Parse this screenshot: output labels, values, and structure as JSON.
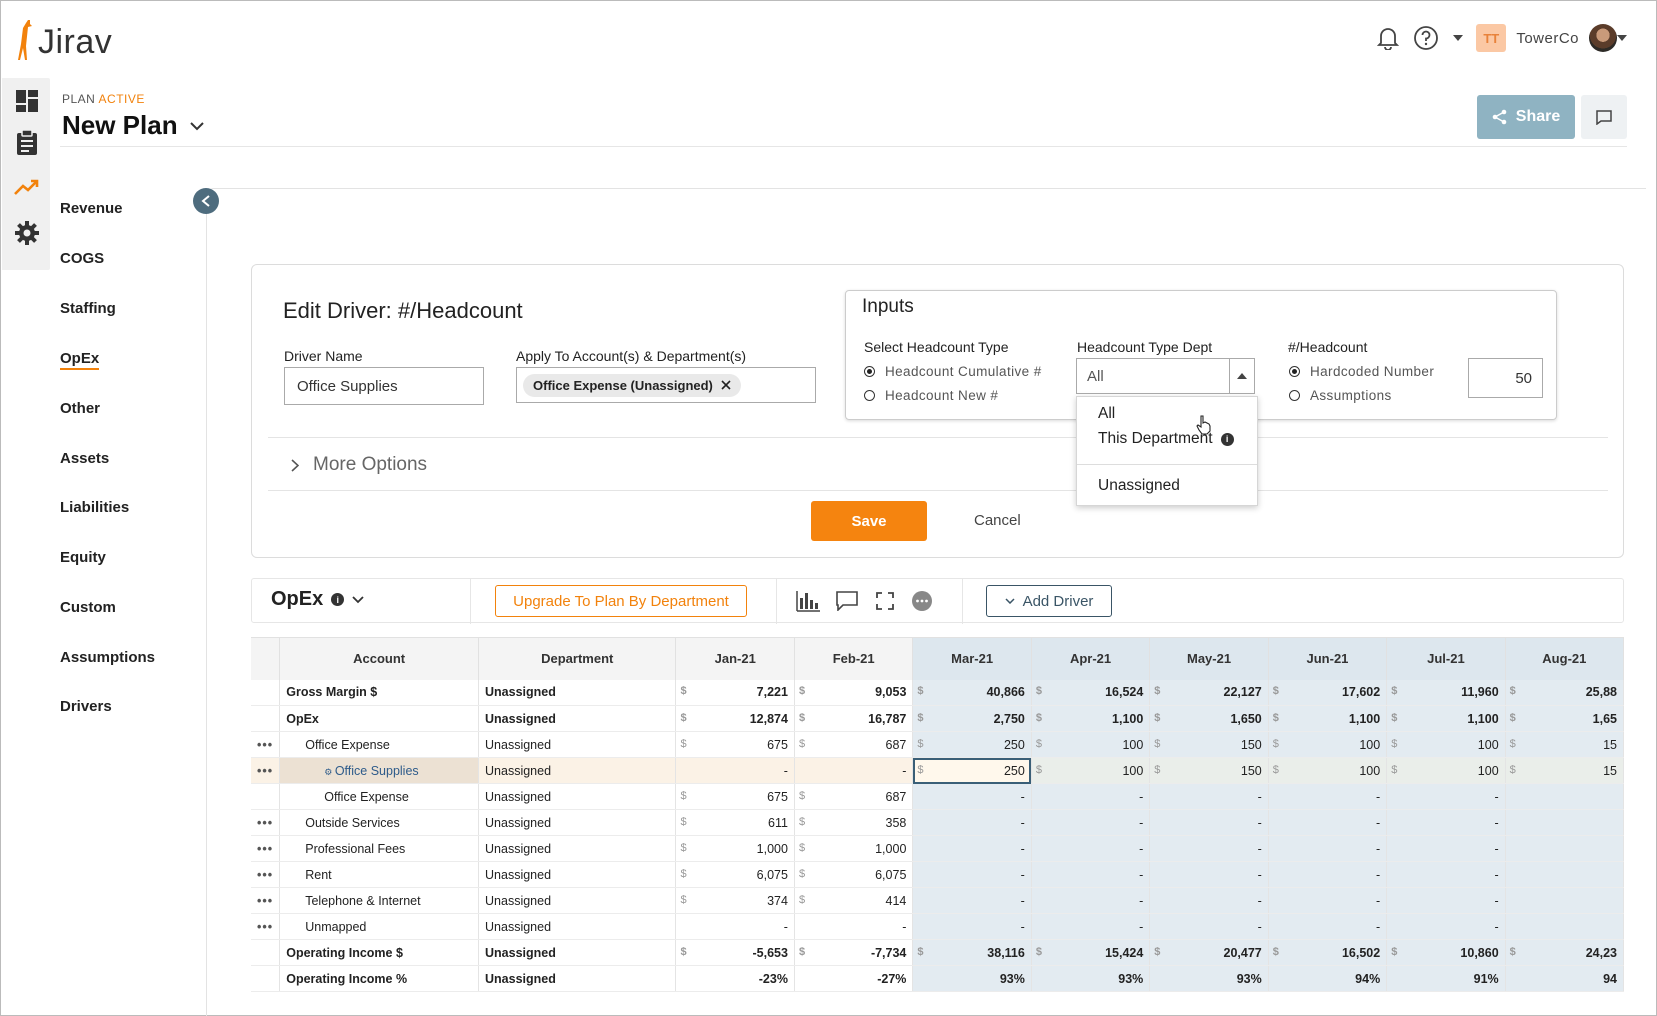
{
  "app": {
    "name": "Jirav"
  },
  "header": {
    "org_initials": "TT",
    "org_name": "TowerCo",
    "plan_label": "PLAN",
    "plan_status": "ACTIVE",
    "plan_name": "New Plan",
    "share_label": "Share"
  },
  "sidebar": {
    "items": [
      {
        "label": "Revenue"
      },
      {
        "label": "COGS"
      },
      {
        "label": "Staffing"
      },
      {
        "label": "OpEx",
        "active": true
      },
      {
        "label": "Other"
      },
      {
        "label": "Assets"
      },
      {
        "label": "Liabilities"
      },
      {
        "label": "Equity"
      },
      {
        "label": "Custom"
      },
      {
        "label": "Assumptions"
      },
      {
        "label": "Drivers"
      }
    ]
  },
  "edit_driver": {
    "title": "Edit Driver: #/Headcount",
    "driver_name_label": "Driver Name",
    "driver_name_value": "Office Supplies",
    "apply_label": "Apply To Account(s) & Department(s)",
    "apply_chip": "Office Expense (Unassigned)",
    "inputs_title": "Inputs",
    "headcount_type_label": "Select Headcount Type",
    "headcount_type_options": [
      {
        "label": "Headcount Cumulative #",
        "selected": true
      },
      {
        "label": "Headcount New #",
        "selected": false
      }
    ],
    "type_dept_label": "Headcount Type Dept",
    "type_dept_value": "All",
    "type_dept_options": [
      "All",
      "This Department",
      "Unassigned"
    ],
    "per_headcount_label": "#/Headcount",
    "per_headcount_options": [
      {
        "label": "Hardcoded Number",
        "selected": true
      },
      {
        "label": "Assumptions",
        "selected": false
      }
    ],
    "per_headcount_value": "50",
    "more_options_label": "More Options",
    "save_label": "Save",
    "cancel_label": "Cancel"
  },
  "toolbar": {
    "title": "OpEx",
    "upgrade_label": "Upgrade To Plan By Department",
    "add_driver_label": "Add Driver"
  },
  "table": {
    "columns": [
      "Account",
      "Department",
      "Jan-21",
      "Feb-21",
      "Mar-21",
      "Apr-21",
      "May-21",
      "Jun-21",
      "Jul-21",
      "Aug-21"
    ],
    "highlight_from_col": 4,
    "rows": [
      {
        "account": "Gross Margin $",
        "dept": "Unassigned",
        "bold": true,
        "dots": false,
        "indent": 0,
        "cells": [
          [
            "$",
            "7,221"
          ],
          [
            "$",
            "9,053"
          ],
          [
            "$",
            "40,866"
          ],
          [
            "$",
            "16,524"
          ],
          [
            "$",
            "22,127"
          ],
          [
            "$",
            "17,602"
          ],
          [
            "$",
            "11,960"
          ],
          [
            "$",
            "25,88"
          ]
        ]
      },
      {
        "account": "OpEx",
        "dept": "Unassigned",
        "bold": true,
        "dots": false,
        "indent": 0,
        "cells": [
          [
            "$",
            "12,874"
          ],
          [
            "$",
            "16,787"
          ],
          [
            "$",
            "2,750"
          ],
          [
            "$",
            "1,100"
          ],
          [
            "$",
            "1,650"
          ],
          [
            "$",
            "1,100"
          ],
          [
            "$",
            "1,100"
          ],
          [
            "$",
            "1,65"
          ]
        ]
      },
      {
        "account": "Office Expense",
        "dept": "Unassigned",
        "bold": false,
        "dots": true,
        "indent": 1,
        "cells": [
          [
            "$",
            "675"
          ],
          [
            "$",
            "687"
          ],
          [
            "$",
            "250"
          ],
          [
            "$",
            "100"
          ],
          [
            "$",
            "150"
          ],
          [
            "$",
            "100"
          ],
          [
            "$",
            "100"
          ],
          [
            "$",
            "15"
          ]
        ]
      },
      {
        "account": "Office Supplies",
        "dept": "Unassigned",
        "bold": false,
        "dots": true,
        "indent": 2,
        "selected": true,
        "sub": true,
        "cells": [
          [
            "",
            "-"
          ],
          [
            "",
            "-"
          ],
          [
            "$",
            "250"
          ],
          [
            "$",
            "100"
          ],
          [
            "$",
            "150"
          ],
          [
            "$",
            "100"
          ],
          [
            "$",
            "100"
          ],
          [
            "$",
            "15"
          ]
        ]
      },
      {
        "account": "Office Expense",
        "dept": "Unassigned",
        "bold": false,
        "dots": false,
        "indent": 2,
        "cells": [
          [
            "$",
            "675"
          ],
          [
            "$",
            "687"
          ],
          [
            "",
            "-"
          ],
          [
            "",
            "-"
          ],
          [
            "",
            "-"
          ],
          [
            "",
            "-"
          ],
          [
            "",
            "-"
          ],
          [
            "",
            ""
          ]
        ]
      },
      {
        "account": "Outside Services",
        "dept": "Unassigned",
        "bold": false,
        "dots": true,
        "indent": 1,
        "cells": [
          [
            "$",
            "611"
          ],
          [
            "$",
            "358"
          ],
          [
            "",
            "-"
          ],
          [
            "",
            "-"
          ],
          [
            "",
            "-"
          ],
          [
            "",
            "-"
          ],
          [
            "",
            "-"
          ],
          [
            "",
            ""
          ]
        ]
      },
      {
        "account": "Professional Fees",
        "dept": "Unassigned",
        "bold": false,
        "dots": true,
        "indent": 1,
        "cells": [
          [
            "$",
            "1,000"
          ],
          [
            "$",
            "1,000"
          ],
          [
            "",
            "-"
          ],
          [
            "",
            "-"
          ],
          [
            "",
            "-"
          ],
          [
            "",
            "-"
          ],
          [
            "",
            "-"
          ],
          [
            "",
            ""
          ]
        ]
      },
      {
        "account": "Rent",
        "dept": "Unassigned",
        "bold": false,
        "dots": true,
        "indent": 1,
        "cells": [
          [
            "$",
            "6,075"
          ],
          [
            "$",
            "6,075"
          ],
          [
            "",
            "-"
          ],
          [
            "",
            "-"
          ],
          [
            "",
            "-"
          ],
          [
            "",
            "-"
          ],
          [
            "",
            "-"
          ],
          [
            "",
            ""
          ]
        ]
      },
      {
        "account": "Telephone & Internet",
        "dept": "Unassigned",
        "bold": false,
        "dots": true,
        "indent": 1,
        "cells": [
          [
            "$",
            "374"
          ],
          [
            "$",
            "414"
          ],
          [
            "",
            "-"
          ],
          [
            "",
            "-"
          ],
          [
            "",
            "-"
          ],
          [
            "",
            "-"
          ],
          [
            "",
            "-"
          ],
          [
            "",
            ""
          ]
        ]
      },
      {
        "account": "Unmapped",
        "dept": "Unassigned",
        "bold": false,
        "dots": true,
        "indent": 1,
        "cells": [
          [
            "",
            "-"
          ],
          [
            "",
            "-"
          ],
          [
            "",
            "-"
          ],
          [
            "",
            "-"
          ],
          [
            "",
            "-"
          ],
          [
            "",
            "-"
          ],
          [
            "",
            "-"
          ],
          [
            "",
            ""
          ]
        ]
      },
      {
        "account": "Operating Income $",
        "dept": "Unassigned",
        "bold": true,
        "dots": false,
        "indent": 0,
        "cells": [
          [
            "$",
            "-5,653"
          ],
          [
            "$",
            "-7,734"
          ],
          [
            "$",
            "38,116"
          ],
          [
            "$",
            "15,424"
          ],
          [
            "$",
            "20,477"
          ],
          [
            "$",
            "16,502"
          ],
          [
            "$",
            "10,860"
          ],
          [
            "$",
            "24,23"
          ]
        ]
      },
      {
        "account": "Operating Income %",
        "dept": "Unassigned",
        "bold": true,
        "dots": false,
        "indent": 0,
        "cells": [
          [
            "",
            "-23%"
          ],
          [
            "",
            "-27%"
          ],
          [
            "",
            "93%"
          ],
          [
            "",
            "93%"
          ],
          [
            "",
            "93%"
          ],
          [
            "",
            "94%"
          ],
          [
            "",
            "91%"
          ],
          [
            "",
            "94"
          ]
        ]
      }
    ]
  },
  "colors": {
    "accent": "#f5840f",
    "brand_slate": "#4e6c7e",
    "share": "#8fb3c2",
    "highlight_col": "#e3ebf1"
  }
}
